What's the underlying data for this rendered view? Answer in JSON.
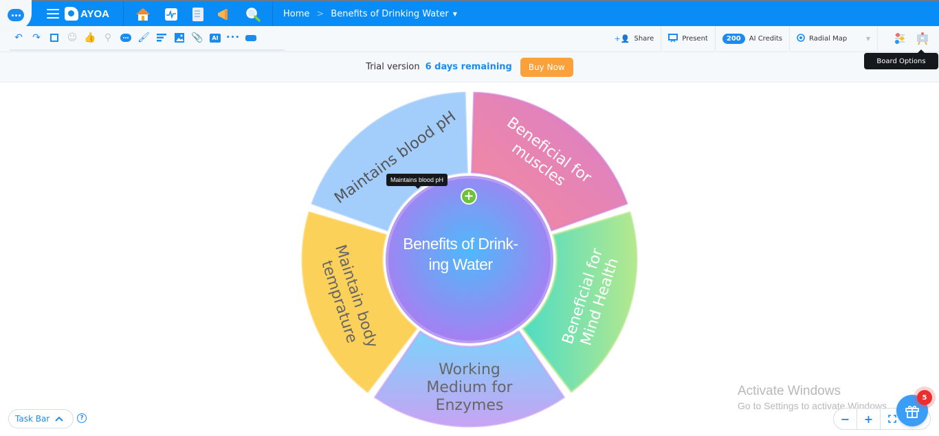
{
  "topbar": {
    "logo_text": "AYOA",
    "nav_icons": [
      "home-icon",
      "activity-icon",
      "notes-icon",
      "announce-icon",
      "search-icon"
    ],
    "breadcrumb": {
      "home": "Home",
      "separator": ">",
      "current": "Benefits of Drinking Water"
    }
  },
  "toolbar": {
    "left_tools": [
      {
        "name": "undo-icon",
        "glyph": "↶",
        "dim": false
      },
      {
        "name": "redo-icon",
        "glyph": "↷",
        "dim": false
      },
      {
        "name": "select-icon",
        "glyph": "⬚",
        "dim": false
      },
      {
        "name": "emoji-icon",
        "glyph": "☺",
        "dim": true
      },
      {
        "name": "like-icon",
        "glyph": "👍",
        "dim": true
      },
      {
        "name": "stamp-icon",
        "glyph": "⚲",
        "dim": true
      },
      {
        "name": "comment-icon",
        "glyph": "💬",
        "dim": false
      },
      {
        "name": "paint-icon",
        "glyph": "🖌",
        "dim": false
      },
      {
        "name": "text-align-icon",
        "glyph": "≡",
        "dim": false
      },
      {
        "name": "image-icon",
        "glyph": "🖼",
        "dim": false
      },
      {
        "name": "attach-icon",
        "glyph": "📎",
        "dim": false
      },
      {
        "name": "ai-icon",
        "glyph": "AI",
        "dim": false
      },
      {
        "name": "more-icon",
        "glyph": "•••",
        "dim": false
      },
      {
        "name": "task-icon",
        "glyph": "▭",
        "dim": false
      }
    ],
    "share_label": "Share",
    "present_label": "Present",
    "ai_credits_count": "200",
    "ai_credits_label": "AI Credits",
    "map_type": "Radial Map",
    "board_options_tooltip": "Board Options"
  },
  "trial": {
    "label": "Trial version",
    "remaining": "6 days remaining",
    "buy_label": "Buy Now"
  },
  "map": {
    "center": "Benefits of Drink- ing Water",
    "center_lines": [
      "Benefits of Drink-",
      "ing Water"
    ],
    "hover_tooltip": "Maintains blood pH",
    "add_label": "+",
    "branches": [
      {
        "lines": [
          "Maintains blood pH"
        ],
        "colors": [
          "#a3cdfb",
          "#a3cdfb"
        ],
        "text_color": "#555"
      },
      {
        "lines": [
          "Beneficial for",
          "muscles"
        ],
        "colors": [
          "#f5899a",
          "#d77fcd"
        ],
        "text_color": "#ffffff"
      },
      {
        "lines": [
          "Beneficial for",
          "Mind Health"
        ],
        "colors": [
          "#4fdcc4",
          "#b4e88e"
        ],
        "text_color": "#ffffff"
      },
      {
        "lines": [
          "Working",
          "Medium for",
          "Enzymes"
        ],
        "colors": [
          "#7bd3fb",
          "#c7a3f3"
        ],
        "text_color": "#666"
      },
      {
        "lines": [
          "Maintain body",
          "temprature"
        ],
        "colors": [
          "#fcd15a",
          "#fcd15a"
        ],
        "text_color": "#666"
      }
    ]
  },
  "bottom": {
    "taskbar_label": "Task Bar",
    "help": "?",
    "zoom_out": "−",
    "zoom_in": "+",
    "gift_badge": "5",
    "activate_title": "Activate Windows",
    "activate_sub": "Go to Settings to activate Windows."
  }
}
